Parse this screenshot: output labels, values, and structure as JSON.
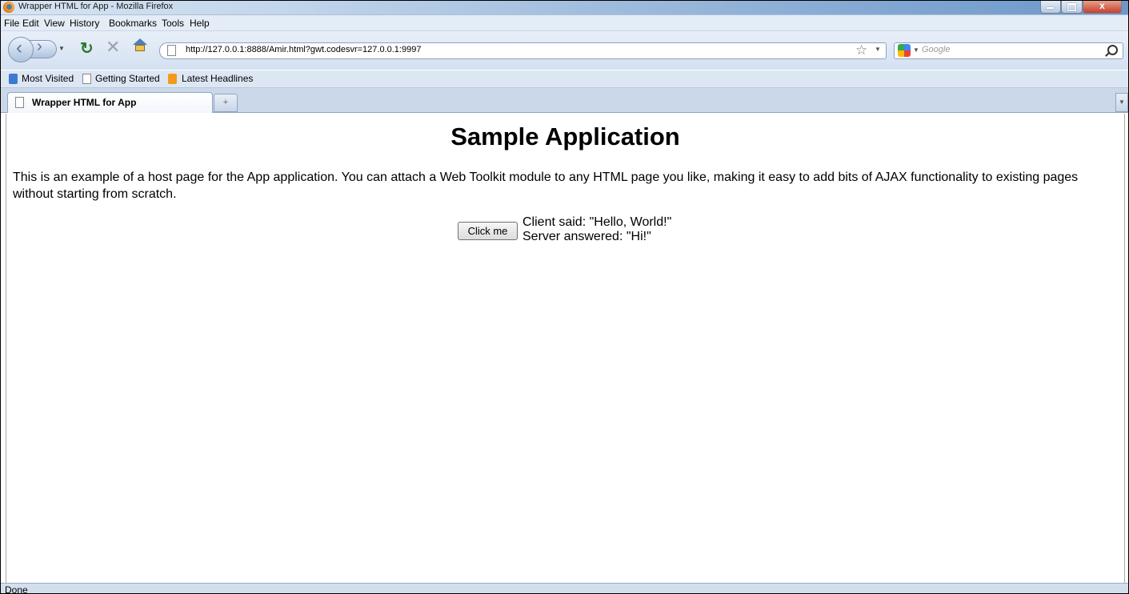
{
  "window": {
    "title": "Wrapper HTML for App - Mozilla Firefox"
  },
  "menu": [
    "File",
    "Edit",
    "View",
    "History",
    "Bookmarks",
    "Tools",
    "Help"
  ],
  "nav": {
    "url": "http://127.0.0.1:8888/Amir.html?gwt.codesvr=127.0.0.1:9997",
    "search_placeholder": "Google"
  },
  "bookmarks": [
    "Most Visited",
    "Getting Started",
    "Latest Headlines"
  ],
  "tabs": [
    {
      "label": "Wrapper HTML for App",
      "active": true
    }
  ],
  "page": {
    "title": "Sample Application",
    "description": "This is an example of a host page for the App application. You can attach a Web Toolkit module to any HTML page you like, making it easy to add bits of AJAX functionality to existing pages without starting from scratch.",
    "button_label": "Click me",
    "client_said": "Client said: \"Hello, World!\"",
    "server_answered": "Server answered: \"Hi!\""
  },
  "status": {
    "text": "Done"
  }
}
